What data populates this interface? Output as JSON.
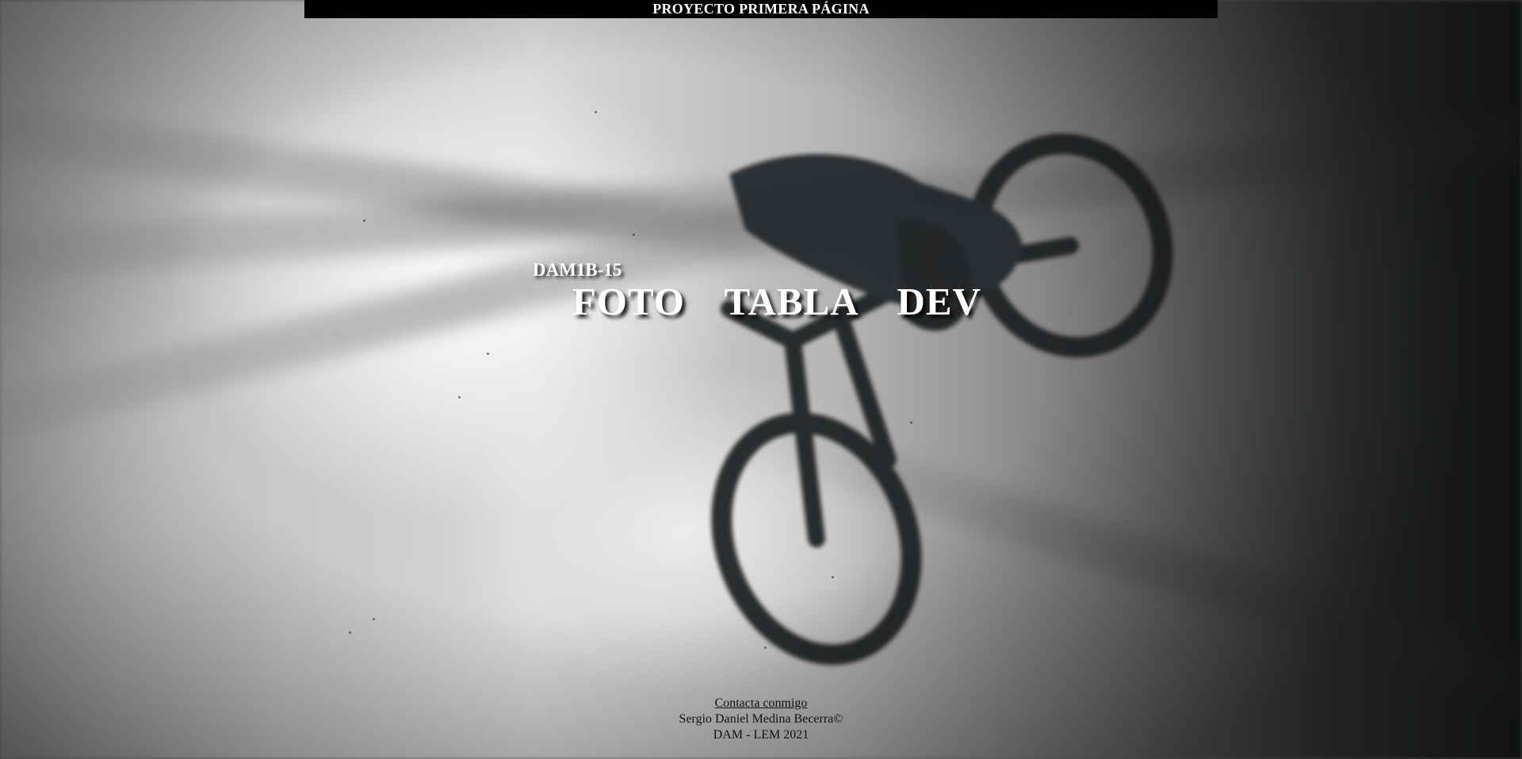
{
  "header": {
    "title": "PROYECTO PRIMERA PÁGINA"
  },
  "hero": {
    "subtitle": "DAM1B-15",
    "title": "FOTO  TABLA  DEV"
  },
  "footer": {
    "contact_link": "Contacta conmigo",
    "author": "Sergio Daniel Medina Becerra©",
    "course": "DAM - LEM 2021"
  },
  "background": {
    "description_icon": "mountain-bike-photo"
  }
}
